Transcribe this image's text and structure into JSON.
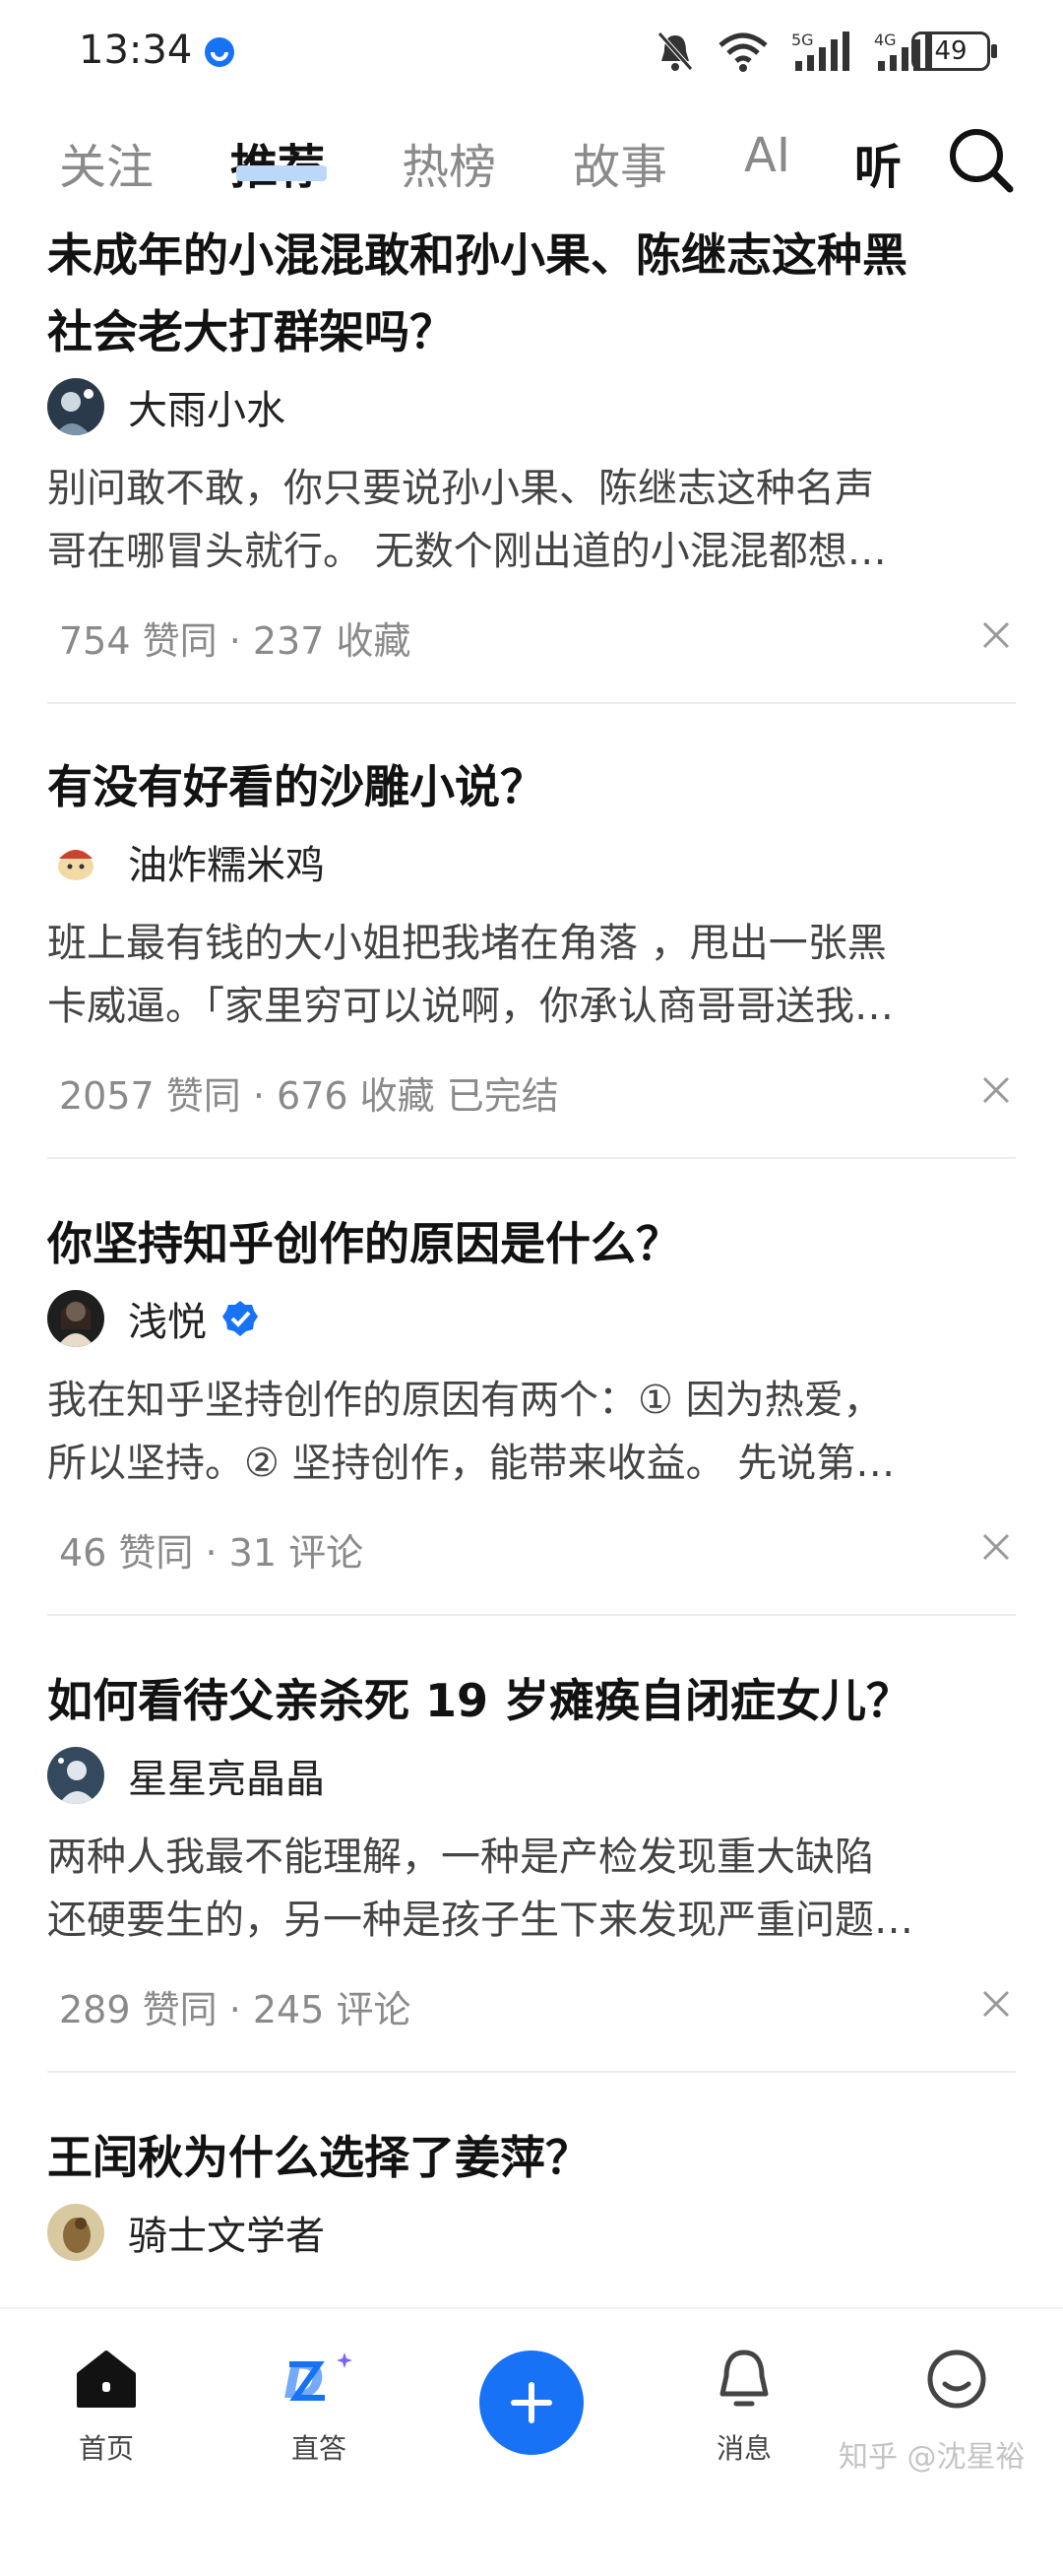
{
  "status_bar": {
    "time": "13:34",
    "battery": "49",
    "icons": [
      "notifications-muted-icon",
      "wifi-icon",
      "5g-signal-icon",
      "4g-signal-icon",
      "battery-icon"
    ]
  },
  "tabs": [
    {
      "label": "关注"
    },
    {
      "label": "推荐"
    },
    {
      "label": "热榜"
    },
    {
      "label": "故事"
    },
    {
      "label": "AI"
    },
    {
      "label": "听"
    }
  ],
  "active_tab": "推荐",
  "accent_color": "#1772f6",
  "feed": [
    {
      "title_line1": "未成年的小混混敢和孙小果、陈继志这种黑",
      "title_line2": "社会老大打群架吗？",
      "author": "大雨小水",
      "excerpt_line1": "别问敢不敢，你只要说孙小果、陈继志这种名声",
      "excerpt_line2": "哥在哪冒头就行。 无数个刚出道的小混混都想…",
      "meta": "754 赞同 · 237 收藏"
    },
    {
      "title_line1": "有没有好看的沙雕小说？",
      "author": "油炸糯米鸡",
      "excerpt_line1": "班上最有钱的大小姐把我堵在角落 ，甩出一张黑",
      "excerpt_line2": "卡威逼。「家里穷可以说啊，你承认商哥哥送我…",
      "meta": "2057 赞同 · 676 收藏 已完结"
    },
    {
      "title_line1": "你坚持知乎创作的原因是什么？",
      "author": "浅悦",
      "excerpt_line1": "我在知乎坚持创作的原因有两个：① 因为热爱，",
      "excerpt_line2": "所以坚持。② 坚持创作，能带来收益。  先说第…",
      "meta": "46 赞同 · 31 评论"
    },
    {
      "title_line1": "如何看待父亲杀死 19 岁瘫痪自闭症女儿？",
      "author": "星星亮晶晶",
      "excerpt_line1": "两种人我最不能理解，一种是产检发现重大缺陷",
      "excerpt_line2": "还硬要生的，另一种是孩子生下来发现严重问题…",
      "meta": "289 赞同 · 245 评论"
    },
    {
      "title_line1": "王闰秋为什么选择了姜萍？",
      "author": "骑士文学者"
    }
  ],
  "bottom_nav": {
    "home": "首页",
    "ask": "直答",
    "messages": "消息",
    "me": ""
  },
  "watermark": "知乎 @沈星裕"
}
